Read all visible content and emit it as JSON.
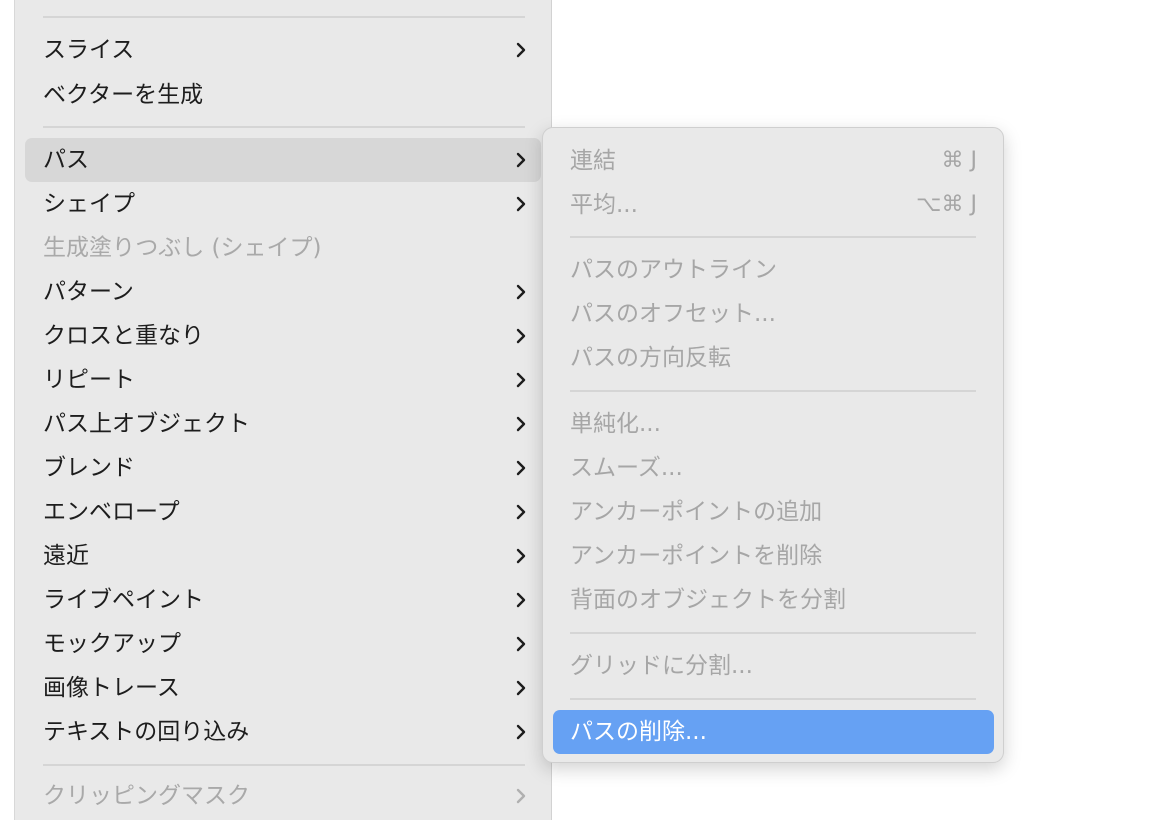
{
  "main_menu": {
    "items": [
      {
        "label": "スライス",
        "submenu": true,
        "disabled": false
      },
      {
        "label": "ベクターを生成",
        "submenu": false,
        "disabled": false
      },
      {
        "label": "パス",
        "submenu": true,
        "disabled": false
      },
      {
        "label": "シェイプ",
        "submenu": true,
        "disabled": false
      },
      {
        "label": "生成塗りつぶし (シェイプ)",
        "submenu": false,
        "disabled": true
      },
      {
        "label": "パターン",
        "submenu": true,
        "disabled": false
      },
      {
        "label": "クロスと重なり",
        "submenu": true,
        "disabled": false
      },
      {
        "label": "リピート",
        "submenu": true,
        "disabled": false
      },
      {
        "label": "パス上オブジェクト",
        "submenu": true,
        "disabled": false
      },
      {
        "label": "ブレンド",
        "submenu": true,
        "disabled": false
      },
      {
        "label": "エンベロープ",
        "submenu": true,
        "disabled": false
      },
      {
        "label": "遠近",
        "submenu": true,
        "disabled": false
      },
      {
        "label": "ライブペイント",
        "submenu": true,
        "disabled": false
      },
      {
        "label": "モックアップ",
        "submenu": true,
        "disabled": false
      },
      {
        "label": "画像トレース",
        "submenu": true,
        "disabled": false
      },
      {
        "label": "テキストの回り込み",
        "submenu": true,
        "disabled": false
      },
      {
        "label": "クリッピングマスク",
        "submenu": true,
        "disabled": true
      }
    ]
  },
  "path_submenu": {
    "items": [
      {
        "label": "連結",
        "shortcut": "⌘ J",
        "disabled": true
      },
      {
        "label": "平均...",
        "shortcut": "⌥⌘ J",
        "disabled": true
      },
      {
        "label": "パスのアウトライン",
        "shortcut": "",
        "disabled": true
      },
      {
        "label": "パスのオフセット...",
        "shortcut": "",
        "disabled": true
      },
      {
        "label": "パスの方向反転",
        "shortcut": "",
        "disabled": true
      },
      {
        "label": "単純化...",
        "shortcut": "",
        "disabled": true
      },
      {
        "label": "スムーズ...",
        "shortcut": "",
        "disabled": true
      },
      {
        "label": "アンカーポイントの追加",
        "shortcut": "",
        "disabled": true
      },
      {
        "label": "アンカーポイントを削除",
        "shortcut": "",
        "disabled": true
      },
      {
        "label": "背面のオブジェクトを分割",
        "shortcut": "",
        "disabled": true
      },
      {
        "label": "グリッドに分割...",
        "shortcut": "",
        "disabled": true
      },
      {
        "label": "パスの削除...",
        "shortcut": "",
        "disabled": false
      }
    ]
  },
  "colors": {
    "menu_bg": "#e9e9e9",
    "highlight_bg": "#d7d7d7",
    "active_bg": "#66a1f3",
    "disabled_text": "#a6a6a6",
    "text": "#1d1d1d"
  }
}
